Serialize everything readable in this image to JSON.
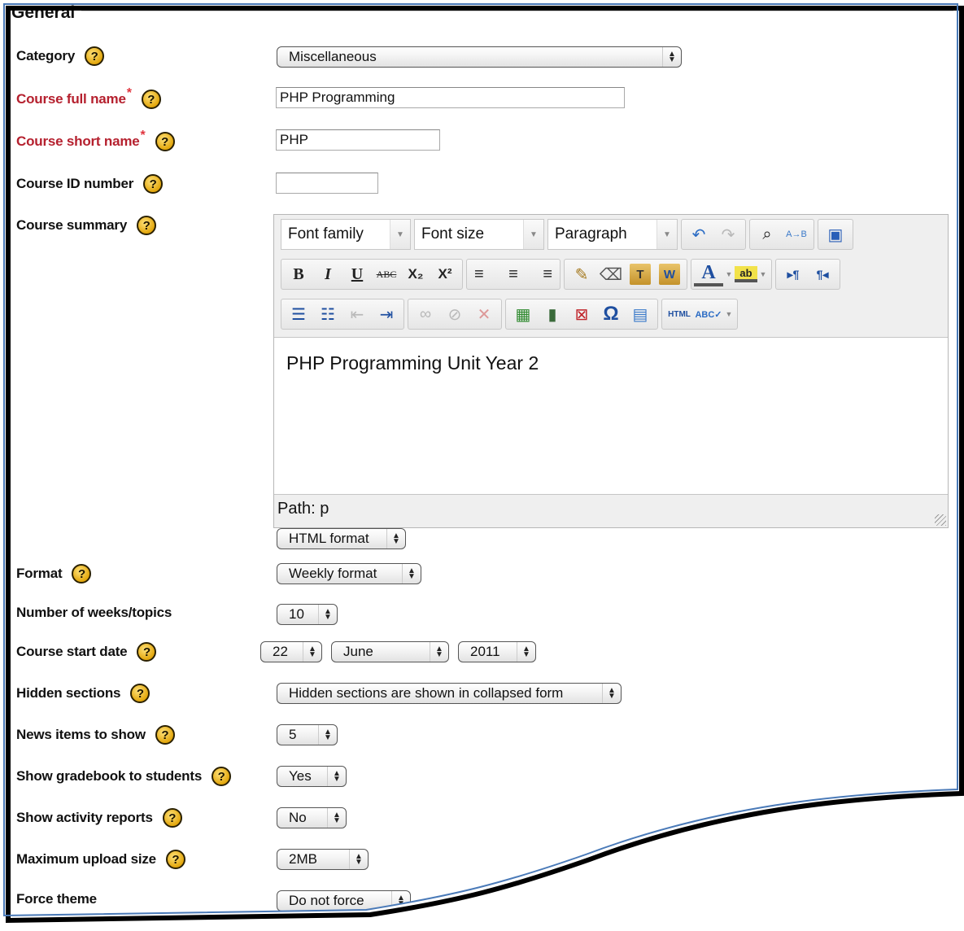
{
  "form": {
    "legend": "General",
    "fields": {
      "category": {
        "label": "Category",
        "value": "Miscellaneous"
      },
      "fullname": {
        "label": "Course full name",
        "required": "*",
        "value": "PHP Programming"
      },
      "shortname": {
        "label": "Course short name",
        "required": "*",
        "value": "PHP"
      },
      "idnumber": {
        "label": "Course ID number",
        "value": ""
      },
      "summary": {
        "label": "Course summary"
      },
      "summary_format": {
        "value": "HTML format"
      },
      "format": {
        "label": "Format",
        "value": "Weekly format"
      },
      "numsections": {
        "label": "Number of weeks/topics",
        "value": "10"
      },
      "startdate": {
        "label": "Course start date",
        "day": "22",
        "month": "June",
        "year": "2011"
      },
      "hiddensections": {
        "label": "Hidden sections",
        "value": "Hidden sections are shown in collapsed form"
      },
      "newsitems": {
        "label": "News items to show",
        "value": "5"
      },
      "showgrades": {
        "label": "Show gradebook to students",
        "value": "Yes"
      },
      "showreports": {
        "label": "Show activity reports",
        "value": "No"
      },
      "maxbytes": {
        "label": "Maximum upload size",
        "value": "2MB"
      },
      "theme": {
        "label": "Force theme",
        "value": "Do not force"
      }
    },
    "help_glyph": "?"
  },
  "editor": {
    "font_family": "Font family",
    "font_size": "Font size",
    "block_format": "Paragraph",
    "content": "PHP Programming Unit Year 2",
    "path": "Path: p",
    "toolbar": {
      "bold": "B",
      "italic": "I",
      "underline": "U",
      "strike": "ABC",
      "subscript": "X₂",
      "superscript": "X²",
      "align_left": "≡",
      "align_center": "≡",
      "align_right": "≡",
      "undo": "↶",
      "redo": "↷",
      "search": "⌕",
      "replace": "A→B",
      "fullscreen": "▣",
      "cleanup": "✎",
      "remove_format": "⌫",
      "paste_text": "T",
      "paste_word": "W",
      "forecolor": "A",
      "backcolor": "ab",
      "ltr": "▸¶",
      "rtl": "¶◂",
      "bullist": "☰",
      "numlist": "☷",
      "outdent": "⇤",
      "indent": "⇥",
      "link": "∞",
      "unlink": "⊘",
      "anchor_remove": "✕",
      "image": "▦",
      "media": "▮",
      "nonbreaking": "⊠",
      "charmap": "Ω",
      "table": "▤",
      "html": "HTML",
      "spellcheck": "ABC✓"
    }
  },
  "colors": {
    "required_label": "#b5202e",
    "help_icon": "#e3a70d",
    "frame_border": "#4a7ab8"
  }
}
